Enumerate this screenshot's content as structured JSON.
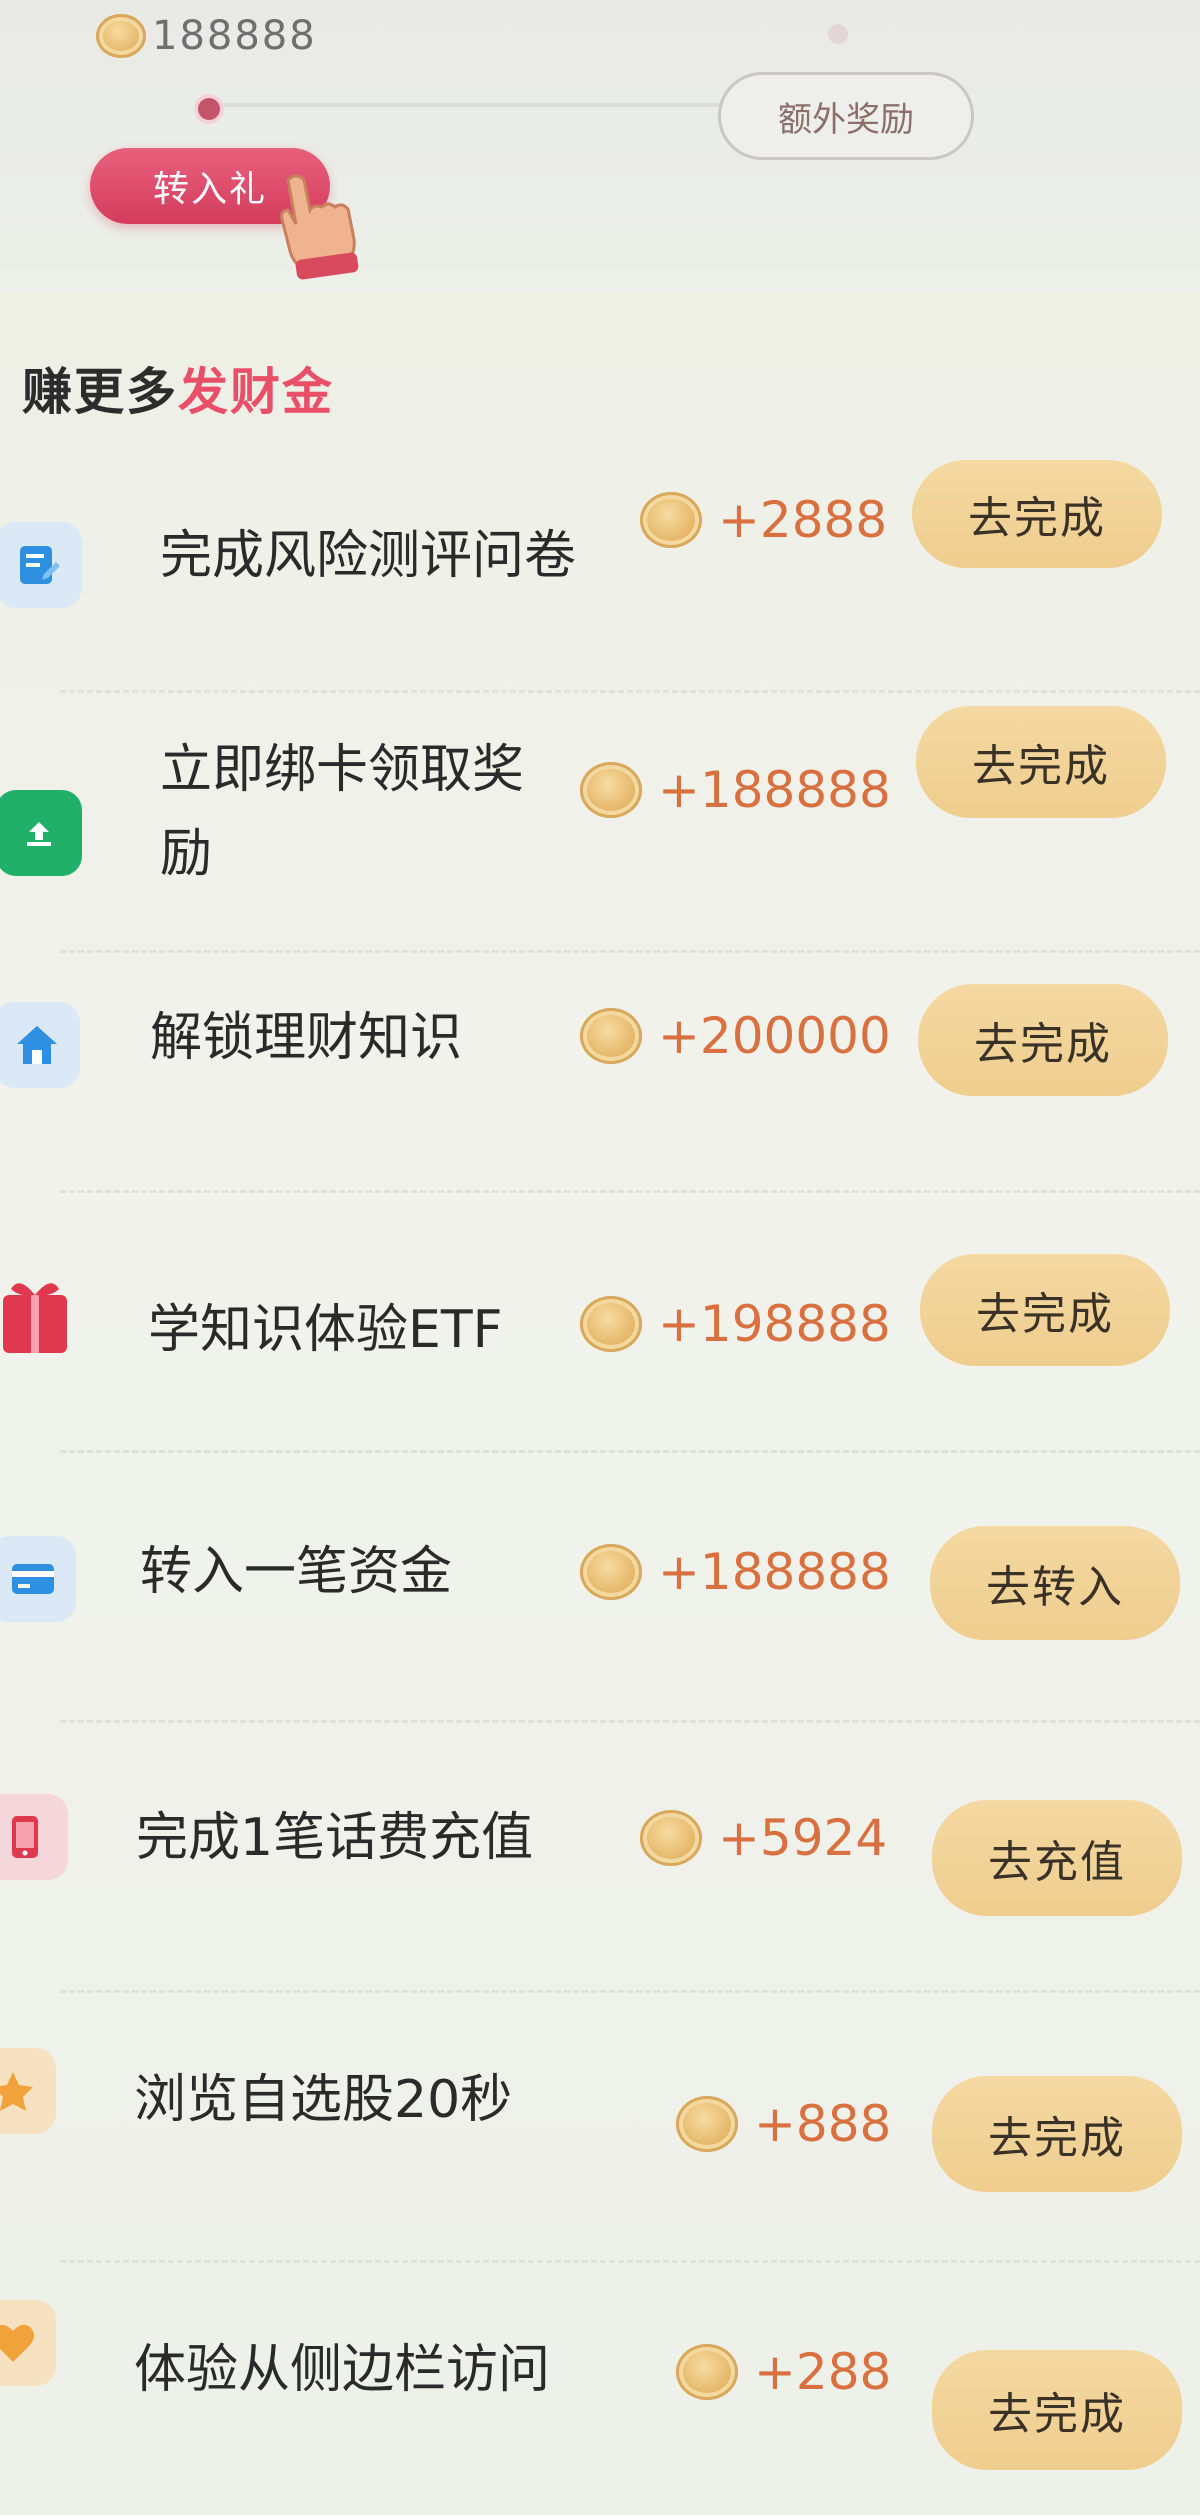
{
  "header": {
    "coin_balance": "188888",
    "transfer_gift_label": "转入礼",
    "extra_reward_label": "额外奖励"
  },
  "section": {
    "title_part1": "赚更多",
    "title_part2": "发财金"
  },
  "colors": {
    "accent": "#ea4f6a",
    "reward": "#d9703f",
    "button_bg": "#f2d498",
    "icon_blue": "#2f8fe0",
    "icon_green": "#21b06a",
    "icon_red": "#e0384f",
    "icon_orange": "#f2a23a"
  },
  "tasks": [
    {
      "title": "完成风险测评问卷",
      "reward": "+2888",
      "button": "去完成",
      "icon": "form-icon"
    },
    {
      "title": "立即绑卡领取奖",
      "title_line2": "励",
      "reward": "+188888",
      "button": "去完成",
      "icon": "bank-card-upload-icon"
    },
    {
      "title": "解锁理财知识",
      "reward": "+200000",
      "button": "去完成",
      "icon": "house-icon"
    },
    {
      "title": "学知识体验ETF",
      "reward": "+198888",
      "button": "去完成",
      "icon": "gift-box-icon"
    },
    {
      "title": "转入一笔资金",
      "reward": "+188888",
      "button": "去转入",
      "icon": "credit-card-icon"
    },
    {
      "title": "完成1笔话费充值",
      "reward": "+5924",
      "button": "去充值",
      "icon": "phone-icon"
    },
    {
      "title": "浏览自选股20秒",
      "reward": "+888",
      "button": "去完成",
      "icon": "star-icon"
    },
    {
      "title": "体验从侧边栏访问",
      "reward": "+288",
      "button": "去完成",
      "icon": "heart-icon"
    }
  ]
}
